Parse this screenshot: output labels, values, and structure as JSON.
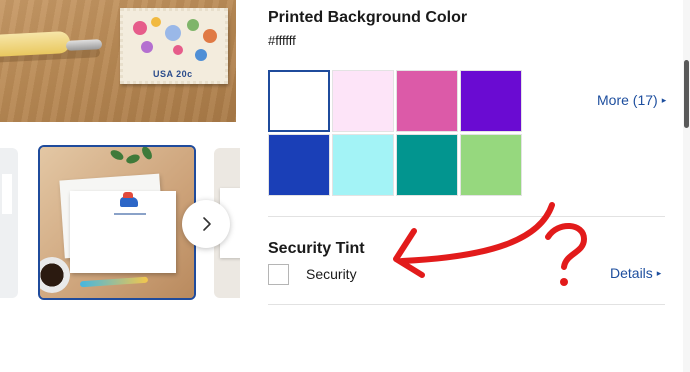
{
  "background_section": {
    "title": "Printed Background Color",
    "selected_hex": "#ffffff",
    "swatches": [
      {
        "color": "#ffffff",
        "selected": true
      },
      {
        "color": "#fde4f8",
        "selected": false
      },
      {
        "color": "#dc5aa8",
        "selected": false
      },
      {
        "color": "#6a0bd2",
        "selected": false
      },
      {
        "color": "#1a3fb7",
        "selected": false
      },
      {
        "color": "#a3f3f6",
        "selected": false
      },
      {
        "color": "#02958f",
        "selected": false
      },
      {
        "color": "#96d87e",
        "selected": false
      }
    ],
    "more_link": "More (17)"
  },
  "security_section": {
    "title": "Security Tint",
    "checkbox_label": "Security",
    "checked": false,
    "details_link": "Details"
  },
  "gallery": {
    "stamp_text": "USA 20c",
    "next_icon": "chevron-right-icon"
  },
  "annotation": {
    "color": "#e21b1b",
    "symbol": "?"
  },
  "colors": {
    "accent": "#1d4e9e",
    "selected_border": "#1f4b9c",
    "text": "#1a1a1a"
  }
}
